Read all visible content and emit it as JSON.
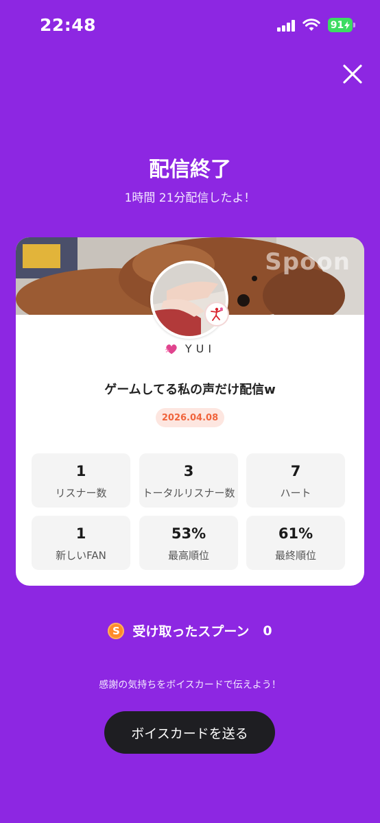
{
  "status_bar": {
    "time": "22:48",
    "battery": "91"
  },
  "header": {
    "title": "配信終了",
    "subtitle": "1時間 21分配信したよ！"
  },
  "card": {
    "banner_logo": "Spoon",
    "username": "YUI",
    "stream_title": "ゲームしてる私の声だけ配信w",
    "date": "2026.04.08",
    "stats": [
      {
        "value": "1",
        "label": "リスナー数"
      },
      {
        "value": "3",
        "label": "トータルリスナー数"
      },
      {
        "value": "7",
        "label": "ハート"
      },
      {
        "value": "1",
        "label": "新しいFAN"
      },
      {
        "value": "53%",
        "label": "最高順位"
      },
      {
        "value": "61%",
        "label": "最終順位"
      }
    ]
  },
  "spoons": {
    "coin_symbol": "S",
    "label": "受け取ったスプーン",
    "count": "0"
  },
  "footer": {
    "thanks_text": "感謝の気持ちをボイスカードで伝えよう！",
    "send_button_label": "ボイスカードを送る"
  },
  "colors": {
    "background": "#8d27e2",
    "date_badge_bg": "#fde6e0",
    "date_badge_text": "#f0643c",
    "coin": "#ff8a2a",
    "button_bg": "#1e1e22"
  },
  "icons": [
    "signal-icon",
    "wifi-icon",
    "battery-icon",
    "close-icon",
    "heart-icon",
    "spoon-coin-icon",
    "avatar-badge-icon"
  ]
}
